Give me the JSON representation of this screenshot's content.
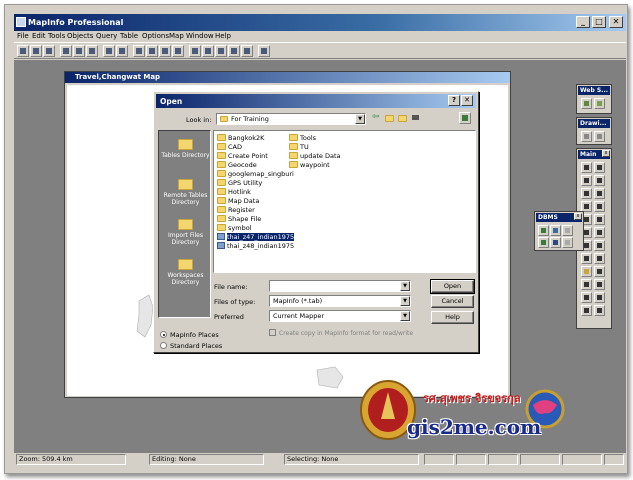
{
  "app": {
    "title": "MapInfo Professional",
    "window_buttons": [
      "_",
      "□",
      "✕"
    ]
  },
  "menu": [
    "File",
    "Edit",
    "Tools",
    "Objects",
    "Query",
    "Table",
    "Options",
    "Map",
    "Window",
    "Help"
  ],
  "map_window": {
    "title": "Travel,Changwat Map"
  },
  "dialog": {
    "title": "Open",
    "look_in_label": "Look in:",
    "look_in_value": "For Training",
    "places": [
      "Tables Directory",
      "Remote Tables Directory",
      "Import Files Directory",
      "Workspaces Directory"
    ],
    "files_col1": [
      "Bangkok2K",
      "CAD",
      "Create Point",
      "Geocode",
      "googlemap_singburi",
      "GPS Utility",
      "Hotlink",
      "Map Data",
      "Register",
      "Shape File",
      "symbol",
      "thai_z47_indian1975",
      "thai_z48_indian1975"
    ],
    "files_col2": [
      "Tools",
      "TU",
      "update Data",
      "waypoint"
    ],
    "selected_file": "thai_z47_indian1975",
    "file_name_label": "File name:",
    "file_name_value": "",
    "files_of_type_label": "Files of type:",
    "files_of_type_value": "MapInfo (*.tab)",
    "preferred_label": "Preferred",
    "preferred_value": "Current Mapper",
    "open_button": "Open",
    "cancel_button": "Cancel",
    "help_button": "Help",
    "radio_mapinfo": "MapInfo Places",
    "radio_standard": "Standard Places",
    "checkbox_copy": "Create copy in MapInfo format for read/write"
  },
  "palettes": {
    "web": "Web S...",
    "drawing": "Drawi...",
    "main": "Main",
    "dbms": "DBMS"
  },
  "status": {
    "zoom": "Zoom: 509.4 km",
    "editing": "Editing: None",
    "selecting": "Selecting: None"
  },
  "branding": {
    "site": "gis2me.com",
    "thai_name": "รศ.สุเพชร จิรขจรกุล"
  }
}
